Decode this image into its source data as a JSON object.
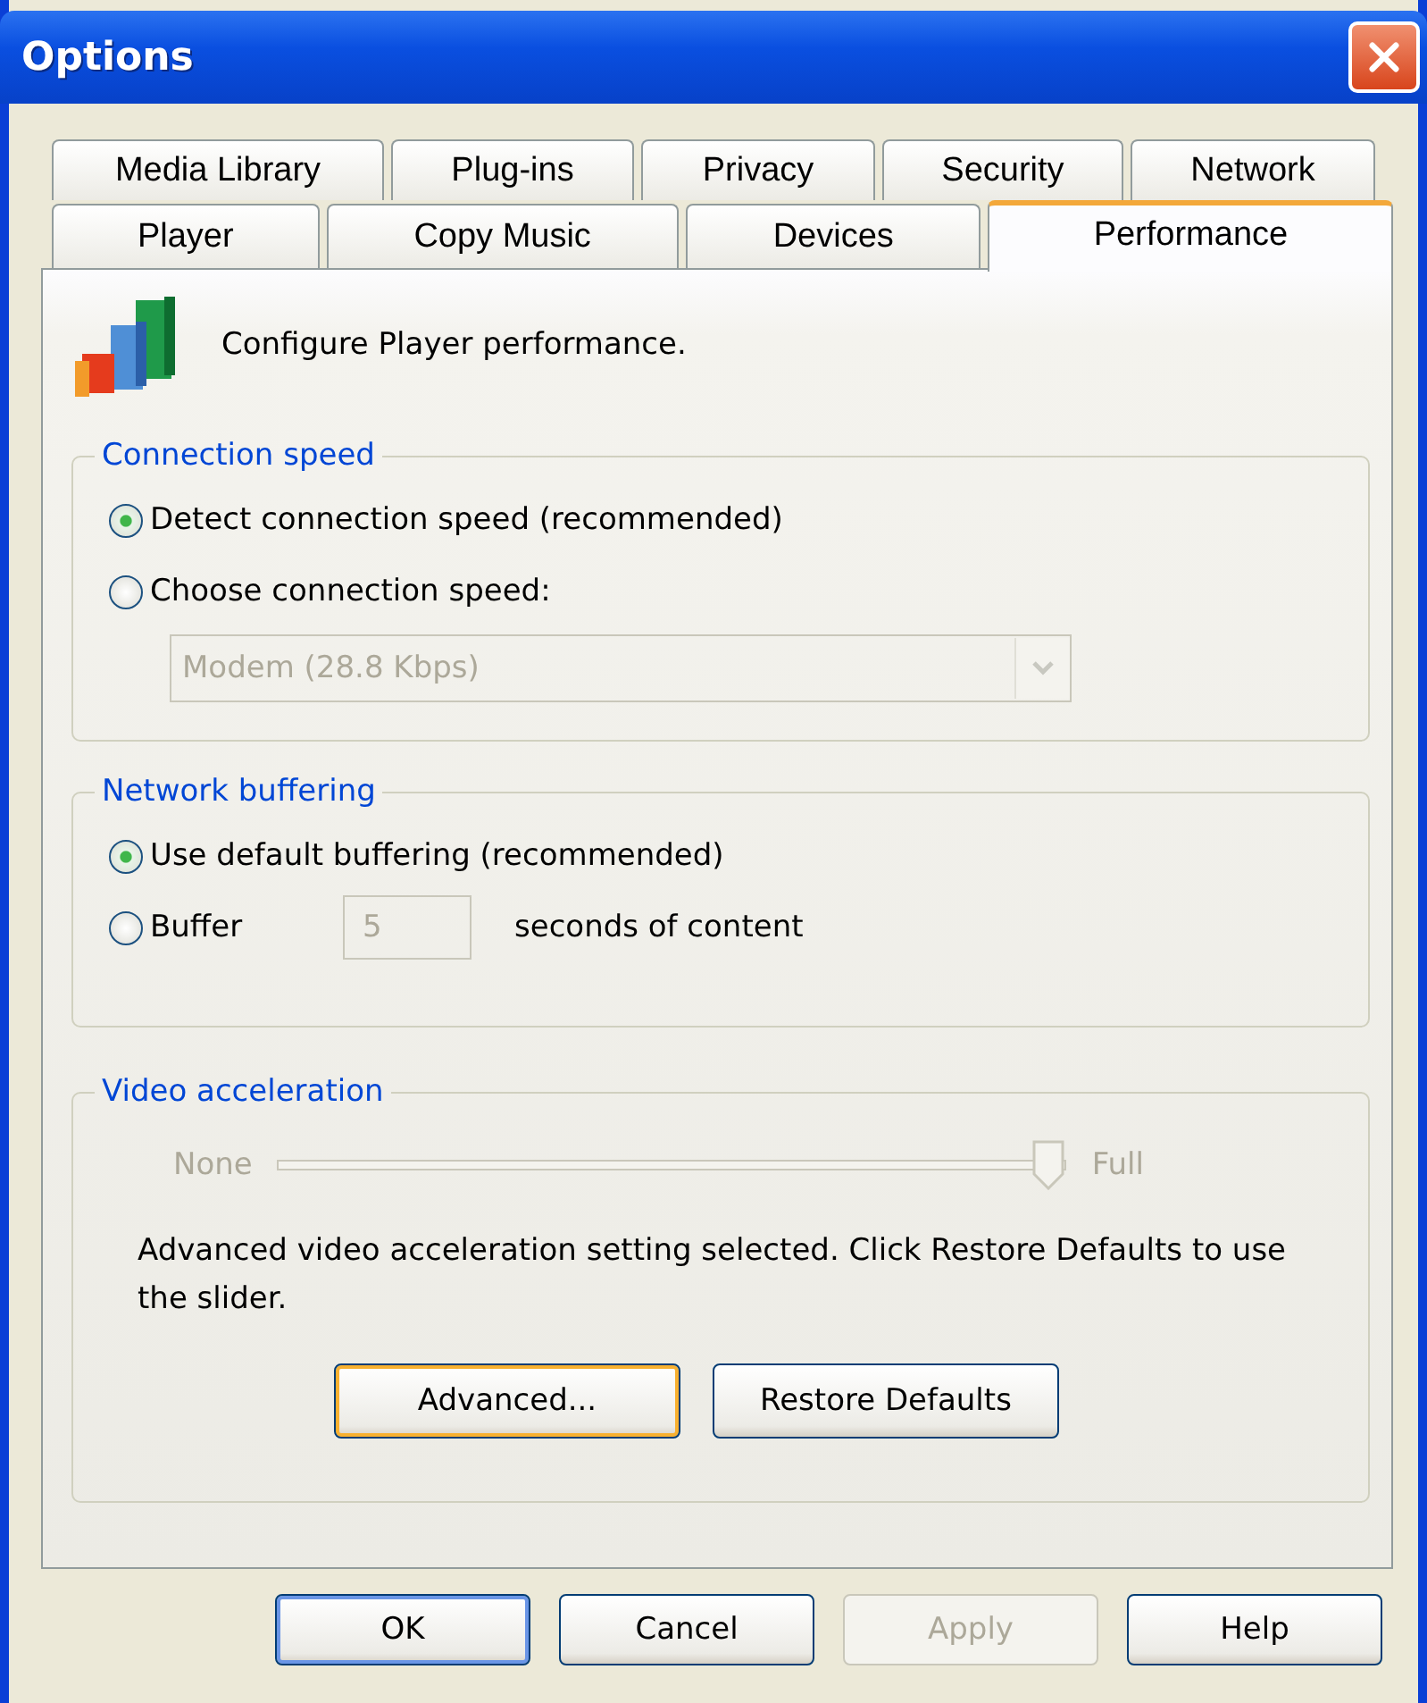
{
  "window": {
    "title": "Options"
  },
  "tab_rows": [
    [
      {
        "label": "Media Library",
        "selected": false
      },
      {
        "label": "Plug-ins",
        "selected": false
      },
      {
        "label": "Privacy",
        "selected": false
      },
      {
        "label": "Security",
        "selected": false
      },
      {
        "label": "Network",
        "selected": false
      }
    ],
    [
      {
        "label": "Player",
        "selected": false
      },
      {
        "label": "Copy Music",
        "selected": false
      },
      {
        "label": "Devices",
        "selected": false
      },
      {
        "label": "Performance",
        "selected": true
      }
    ]
  ],
  "intro": "Configure Player performance.",
  "connection_speed": {
    "title": "Connection speed",
    "options": [
      {
        "label": "Detect connection speed (recommended)",
        "selected": true
      },
      {
        "label": "Choose connection speed:",
        "selected": false
      }
    ],
    "dropdown": {
      "value": "Modem (28.8 Kbps)",
      "disabled": true
    }
  },
  "network_buffering": {
    "title": "Network buffering",
    "options": [
      {
        "label": "Use default buffering (recommended)",
        "selected": true
      },
      {
        "label": "Buffer",
        "selected": false
      }
    ],
    "seconds": {
      "value": "5",
      "disabled": true
    },
    "suffix": "seconds of content"
  },
  "video_acceleration": {
    "title": "Video acceleration",
    "min_label": "None",
    "max_label": "Full",
    "level": 1,
    "disabled": true,
    "note": "Advanced video acceleration setting selected. Click Restore Defaults to use the slider.",
    "buttons": [
      {
        "label": "Advanced...",
        "kind": "focused",
        "disabled": false
      },
      {
        "label": "Restore Defaults",
        "kind": "normal",
        "disabled": false
      }
    ]
  },
  "buttons": [
    {
      "label": "OK",
      "kind": "default",
      "disabled": false
    },
    {
      "label": "Cancel",
      "kind": "normal",
      "disabled": false
    },
    {
      "label": "Apply",
      "kind": "normal",
      "disabled": true
    },
    {
      "label": "Help",
      "kind": "normal",
      "disabled": false
    }
  ]
}
